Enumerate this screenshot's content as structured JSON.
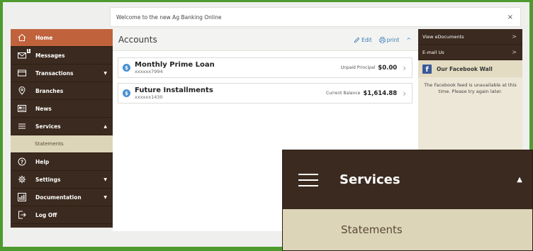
{
  "banner": {
    "text": "Welcome to the new Ag Banking Online",
    "close": "×"
  },
  "sidebar": {
    "items": [
      {
        "label": "Home",
        "icon": "home-icon",
        "active": true
      },
      {
        "label": "Messages",
        "icon": "mail-icon",
        "badge": "1"
      },
      {
        "label": "Transactions",
        "icon": "card-icon",
        "caret": "▼"
      },
      {
        "label": "Branches",
        "icon": "location-icon"
      },
      {
        "label": "News",
        "icon": "news-icon"
      },
      {
        "label": "Services",
        "icon": "menu-icon",
        "caret": "▲"
      },
      {
        "label": "Statements",
        "sub": true
      },
      {
        "label": "Help",
        "icon": "help-icon"
      },
      {
        "label": "Settings",
        "icon": "gear-icon",
        "caret": "▼"
      },
      {
        "label": "Documentation",
        "icon": "chart-icon",
        "caret": "▼"
      },
      {
        "label": "Log Off",
        "icon": "logoff-icon"
      }
    ]
  },
  "main": {
    "title": "Accounts",
    "edit_label": "Edit",
    "print_label": "print",
    "collapse": "^",
    "accounts": [
      {
        "name": "Monthly Prime Loan",
        "number": "xxxxxx7994",
        "label": "Unpaid Principal",
        "value": "$0.00"
      },
      {
        "name": "Future Installments",
        "number": "xxxxxx1430",
        "label": "Current Balance",
        "value": "$1,614.88"
      }
    ]
  },
  "right": {
    "links": [
      {
        "label": "View eDocuments",
        "chevron": ">"
      },
      {
        "label": "E-mail Us",
        "chevron": ">"
      }
    ],
    "facebook_title": "Our Facebook Wall",
    "facebook_text": "The Facebook feed is unavailable at this time. Please try again later."
  },
  "zoom": {
    "services_label": "Services",
    "caret": "▲",
    "statements_label": "Statements"
  },
  "colors": {
    "background": "#4d9a2e",
    "sidebar": "#3b2a1f",
    "active": "#c0623c",
    "submenu": "#ddd5b8",
    "link": "#3a7ab8"
  }
}
